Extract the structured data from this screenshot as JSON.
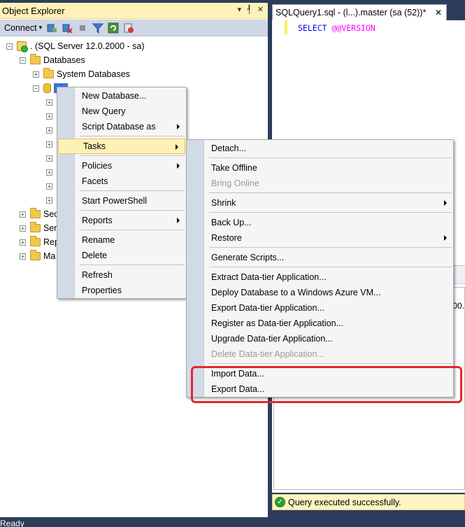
{
  "object_explorer": {
    "title": "Object Explorer",
    "pin_glyph": "▾ ✓ ✕",
    "toolbar": {
      "connect_label": "Connect"
    },
    "tree": {
      "server": ". (SQL Server 12.0.2000 - sa)",
      "databases": "Databases",
      "system_databases": "System Databases",
      "partial_items": [
        "Sec",
        "Ser",
        "Rep",
        "Ma"
      ]
    }
  },
  "query_editor": {
    "tab_title": "SQLQuery1.sql - (l...).master (sa (52))*",
    "code_keyword": "SELECT",
    "code_function": "@@VERSION",
    "result_partial": "00.",
    "status_message": "Query executed successfully."
  },
  "app_status": "Ready",
  "db_context_menu": {
    "items": [
      {
        "label": "New Database..."
      },
      {
        "label": "New Query"
      },
      {
        "label": "Script Database as"
      },
      {
        "label": "Tasks"
      },
      {
        "label": "Policies"
      },
      {
        "label": "Facets"
      },
      {
        "label": "Start PowerShell"
      },
      {
        "label": "Reports"
      },
      {
        "label": "Rename"
      },
      {
        "label": "Delete"
      },
      {
        "label": "Refresh"
      },
      {
        "label": "Properties"
      }
    ]
  },
  "tasks_submenu": {
    "items": [
      {
        "label": "Detach..."
      },
      {
        "label": "Take Offline"
      },
      {
        "label": "Bring Online"
      },
      {
        "label": "Shrink"
      },
      {
        "label": "Back Up..."
      },
      {
        "label": "Restore"
      },
      {
        "label": "Generate Scripts..."
      },
      {
        "label": "Extract Data-tier Application..."
      },
      {
        "label": "Deploy Database to a Windows Azure VM..."
      },
      {
        "label": "Export Data-tier Application..."
      },
      {
        "label": "Register as Data-tier Application..."
      },
      {
        "label": "Upgrade Data-tier Application..."
      },
      {
        "label": "Delete Data-tier Application..."
      },
      {
        "label": "Import Data..."
      },
      {
        "label": "Export Data..."
      }
    ]
  },
  "colors": {
    "highlight_box": "#e8262b",
    "menu_hover": "#fdf1b8",
    "selection": "#3875d6"
  }
}
